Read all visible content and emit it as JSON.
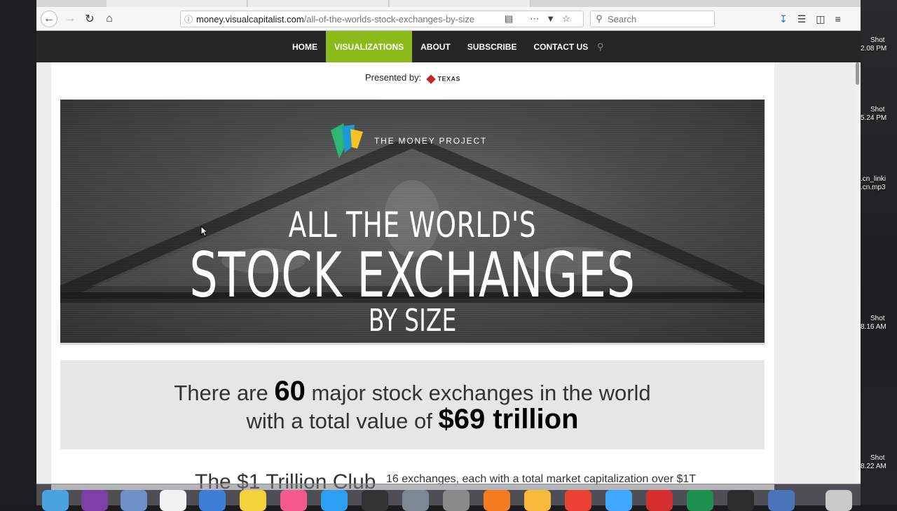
{
  "browser": {
    "url_host": "money.visualcapitalist.com",
    "url_path": "/all-of-the-worlds-stock-exchanges-by-size",
    "search_placeholder": "Search"
  },
  "nav": {
    "items": [
      "HOME",
      "VISUALIZATIONS",
      "ABOUT",
      "SUBSCRIBE",
      "CONTACT US"
    ],
    "active_index": 1,
    "active_color": "#8bbb1a"
  },
  "presented": {
    "label": "Presented by:",
    "sponsor_text": "TEXAS"
  },
  "hero": {
    "brand": "THE MONEY PROJECT",
    "line1": "ALL THE WORLD'S",
    "line2": "STOCK EXCHANGES",
    "line3": "BY SIZE"
  },
  "stat": {
    "prefix1": "There are ",
    "count": "60",
    "suffix1": " major stock exchanges in the world",
    "prefix2": "with a total value of ",
    "value": "$69 trillion"
  },
  "club": {
    "title": "The $1 Trillion Club",
    "desc": "16 exchanges, each with a total market capitalization over $1T"
  },
  "desktop": {
    "items": [
      {
        "l1": "Shot",
        "l2": "2.08 PM"
      },
      {
        "l1": "Shot",
        "l2": "5.24 PM"
      },
      {
        "l1": ".cn_linki",
        "l2": ".cn.mp3"
      },
      {
        "l1": "Shot",
        "l2": "8.16 AM"
      },
      {
        "l1": "Shot",
        "l2": "8.22 AM"
      }
    ]
  }
}
